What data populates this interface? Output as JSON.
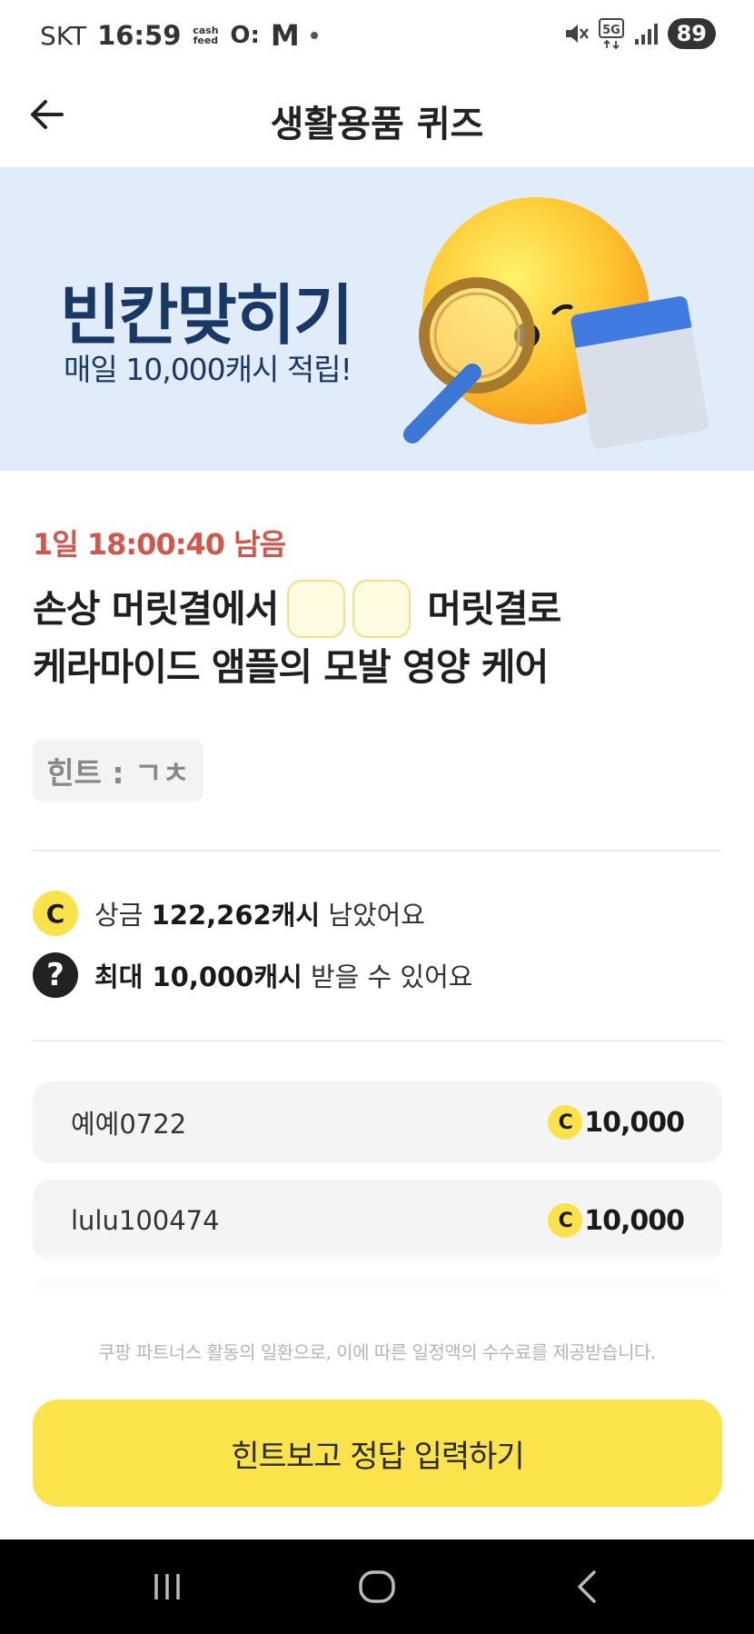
{
  "status_bar": {
    "carrier": "SKT",
    "time": "16:59",
    "cashfeed": "cash\nfeed",
    "app_icon_oc": "O:",
    "app_icon_m": "M",
    "network": "5G",
    "battery": "89"
  },
  "header": {
    "title": "생활용품 퀴즈"
  },
  "banner": {
    "title": "빈칸맞히기",
    "subtitle": "매일 10,000캐시 적립!"
  },
  "quiz": {
    "timer": "1일 18:00:40 남음",
    "line1_before": "손상 머릿결에서",
    "line1_after": "머릿결로",
    "line2": "케라마이드 앰플의 모발 영양 케어",
    "hint": "힌트 : ㄱㅊ"
  },
  "info": {
    "prize_prefix": "상금",
    "prize_amount": "122,262캐시",
    "prize_suffix": "남았어요",
    "max_prefix": "최대 10,000캐시",
    "max_suffix": "받을 수 있어요",
    "coin_symbol": "C",
    "question_symbol": "?"
  },
  "winners": [
    {
      "name": "예예0722",
      "amount": "10,000"
    },
    {
      "name": "lulu100474",
      "amount": "10,000"
    }
  ],
  "disclaimer": "쿠팡 파트너스 활동의 일환으로, 이에 따른 일정액의 수수료를 제공받습니다.",
  "cta": {
    "label": "힌트보고 정답 입력하기"
  },
  "colors": {
    "accent_yellow": "#fbe34c",
    "timer_red": "#d0574a",
    "banner_bg": "#e1ecfb",
    "banner_text": "#1a3866"
  },
  "icons": {
    "back": "arrow-left-icon",
    "mute": "mute-icon",
    "signal": "signal-icon",
    "nav_recent": "recent-apps-icon",
    "nav_home": "home-icon",
    "nav_back": "back-icon"
  }
}
